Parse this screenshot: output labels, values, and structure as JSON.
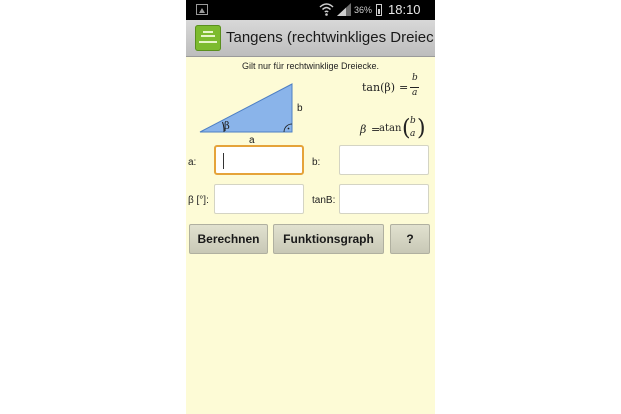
{
  "status_bar": {
    "battery_pct": "36%",
    "time": "18:10"
  },
  "app": {
    "title": "Tangens (rechtwinkliges Dreiec…"
  },
  "note": "Gilt nur für rechtwinklige Dreiecke.",
  "figure": {
    "label_b": "b",
    "label_a": "a",
    "label_beta": "β"
  },
  "formulas": {
    "tan": {
      "lhs": "tan(β)",
      "eq": "=",
      "num": "b",
      "den": "a"
    },
    "atan": {
      "lhs": "β",
      "eq": "=",
      "fn": "atan",
      "num": "b",
      "den": "a"
    }
  },
  "fields": {
    "a": {
      "label": "a:",
      "value": ""
    },
    "b": {
      "label": "b:",
      "value": ""
    },
    "beta": {
      "label": "β [°]:",
      "value": ""
    },
    "tanb": {
      "label": "tanB:",
      "value": ""
    }
  },
  "buttons": {
    "calculate": "Berechnen",
    "graph": "Funktionsgraph",
    "help": "?"
  },
  "colors": {
    "background": "#fdfbd6",
    "focus_border": "#e5a33a",
    "triangle_fill": "#8ab4ea",
    "app_icon": "#7dbb2e"
  }
}
